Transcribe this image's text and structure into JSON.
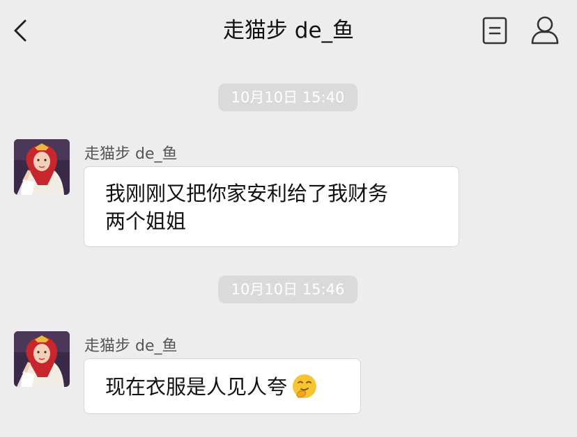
{
  "header": {
    "title": "走猫步 de_鱼"
  },
  "messages": [
    {
      "time": "10月10日 15:40",
      "sender": "走猫步 de_鱼",
      "lines": [
        "我刚刚又把你家安利给了我财务",
        "两个姐姐"
      ]
    },
    {
      "time": "10月10日 15:46",
      "sender": "走猫步 de_鱼",
      "text": "现在衣服是人见人夸",
      "emoji": "smirk-hand-emoji"
    }
  ],
  "icons": {
    "back": "chevron-left-icon",
    "doc": "document-icon",
    "profile": "person-icon"
  }
}
